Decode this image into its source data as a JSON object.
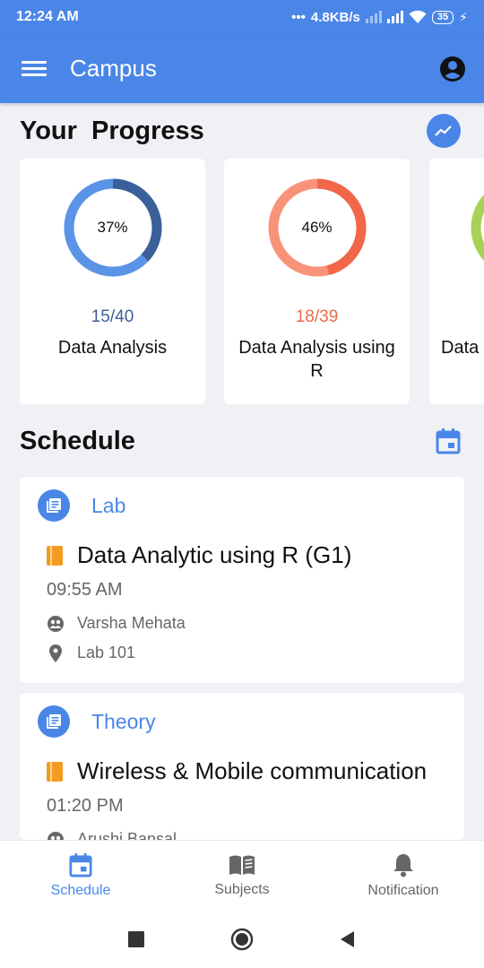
{
  "status_bar": {
    "time": "12:24 AM",
    "net_speed": "4.8KB/s",
    "battery": "35"
  },
  "app_bar": {
    "title": "Campus"
  },
  "progress": {
    "title": "Your  Progress",
    "cards": [
      {
        "percent_label": "37%",
        "fraction": 0.37,
        "count": "15/40",
        "name": "Data Analysis",
        "color_main": "#5b93e6",
        "color_done": "#3b5f99",
        "count_color": "#3b5f99"
      },
      {
        "percent_label": "46%",
        "fraction": 0.46,
        "count": "18/39",
        "name": "Data Analysis using R",
        "color_main": "#f8937a",
        "color_done": "#f2664a",
        "count_color": "#ee6a48"
      },
      {
        "percent_label": "",
        "fraction": 0.0,
        "count": "",
        "name": "Data",
        "color_main": "#a9d156",
        "color_done": "#a9d156",
        "count_color": "#a9d156"
      }
    ]
  },
  "schedule": {
    "title": "Schedule",
    "items": [
      {
        "type": "Lab",
        "subject": "Data Analytic using R (G1)",
        "time": "09:55 AM",
        "teacher": "Varsha Mehata",
        "room": "Lab 101"
      },
      {
        "type": "Theory",
        "subject": "Wireless & Mobile communication",
        "time": "01:20 PM",
        "teacher": "Arushi Bansal"
      }
    ]
  },
  "bottom_nav": {
    "schedule": "Schedule",
    "subjects": "Subjects",
    "notification": "Notification"
  },
  "colors": {
    "primary": "#4a86e8",
    "accent_book": "#f59b1f",
    "background": "#f0f1f5"
  }
}
